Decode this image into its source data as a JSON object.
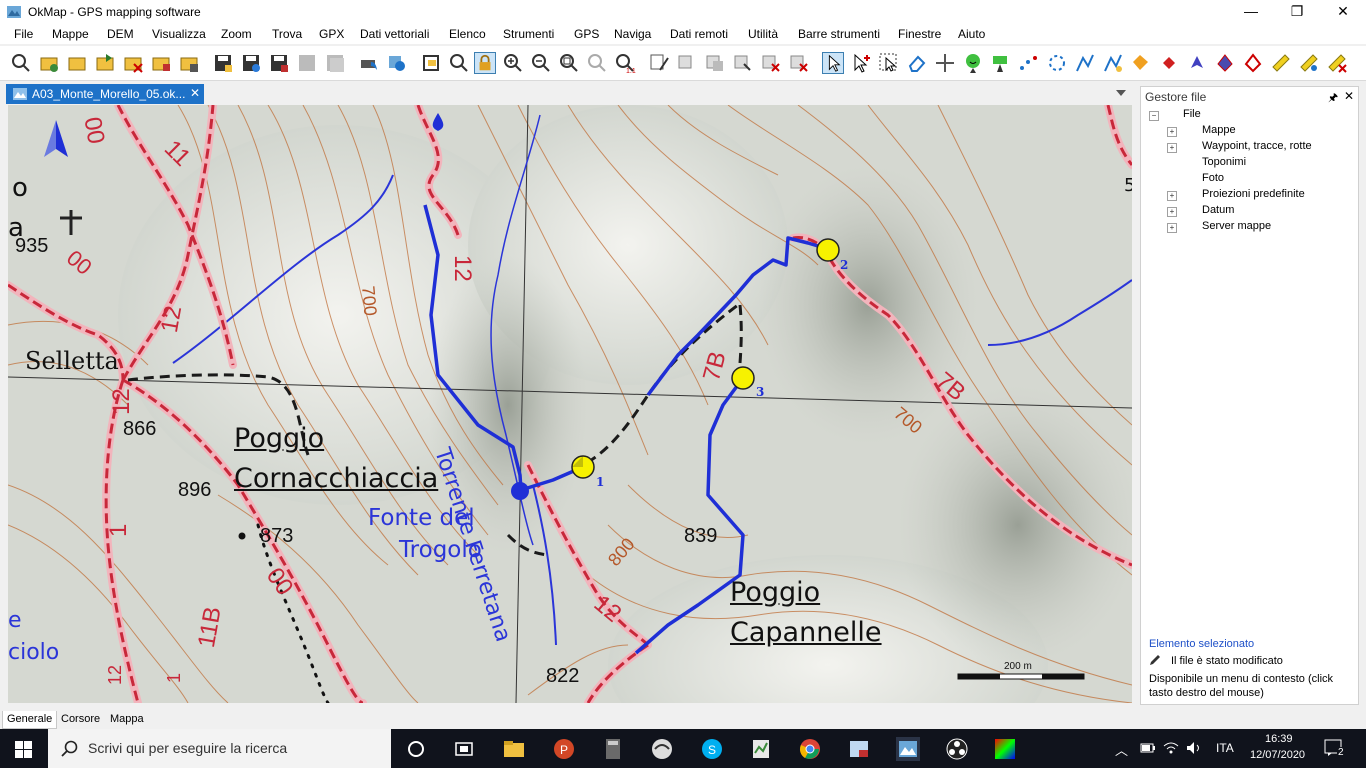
{
  "window": {
    "title": "OkMap - GPS mapping software",
    "minimize_glyph": "—",
    "maximize_glyph": "❐",
    "close_glyph": "✕"
  },
  "menu": [
    "File",
    "Mappe",
    "DEM",
    "Visualizza",
    "Zoom",
    "Trova",
    "GPX",
    "Dati vettoriali",
    "Elenco",
    "Strumenti",
    "GPS",
    "Naviga",
    "Dati remoti",
    "Utilità",
    "Barre strumenti",
    "Finestre",
    "Aiuto"
  ],
  "document_tab": {
    "label": "A03_Monte_Morello_05.ok...",
    "close_glyph": "✕"
  },
  "map": {
    "place_labels": [
      "Selletta",
      "Poggio",
      "Cornacchiaccia",
      "Fonte del",
      "Trogolo",
      "Poggio",
      "Capannelle",
      "Torrente Ferretana",
      "o",
      "a",
      "e",
      "ciolo",
      "5"
    ],
    "elevations": [
      "935",
      "866",
      "896",
      "873",
      "839",
      "822"
    ],
    "contour_labels": [
      "700",
      "700",
      "800"
    ],
    "trail_labels": [
      "11",
      "00",
      "12",
      "12",
      "12",
      "12",
      "1",
      "00",
      "11B",
      "7B",
      "7B",
      "12",
      "1",
      "00"
    ],
    "waypoints": [
      "1",
      "2",
      "3"
    ],
    "scale_label": "200 m",
    "north_arrow": "north-arrow-icon"
  },
  "panel": {
    "title": "Gestore file",
    "pin_glyph": "📌",
    "close_glyph": "✕",
    "root": "File",
    "items": [
      {
        "label": "Mappe",
        "expandable": true
      },
      {
        "label": "Waypoint, tracce, rotte",
        "expandable": true
      },
      {
        "label": "Toponimi",
        "expandable": false
      },
      {
        "label": "Foto",
        "expandable": false
      },
      {
        "label": "Proiezioni predefinite",
        "expandable": true
      },
      {
        "label": "Datum",
        "expandable": true
      },
      {
        "label": "Server mappe",
        "expandable": true
      }
    ],
    "selected_title": "Elemento selezionato",
    "status_modified": "Il file è stato modificato",
    "status_context": "Disponibile un menu di contesto (click tasto destro del mouse)"
  },
  "bottom_tabs": [
    "Generale",
    "Corsore",
    "Mappa"
  ],
  "taskbar": {
    "search_placeholder": "Scrivi qui per eseguire la ricerca",
    "language": "ITA",
    "time": "16:39",
    "date": "12/07/2020",
    "notifications": "2"
  },
  "colors": {
    "accent": "#1e72c8",
    "track_blue": "#1f2fd6",
    "trail_red": "#c8283a",
    "contour": "#c0703a",
    "map_bg": "#d2d6cf",
    "taskbar": "#10131c"
  }
}
